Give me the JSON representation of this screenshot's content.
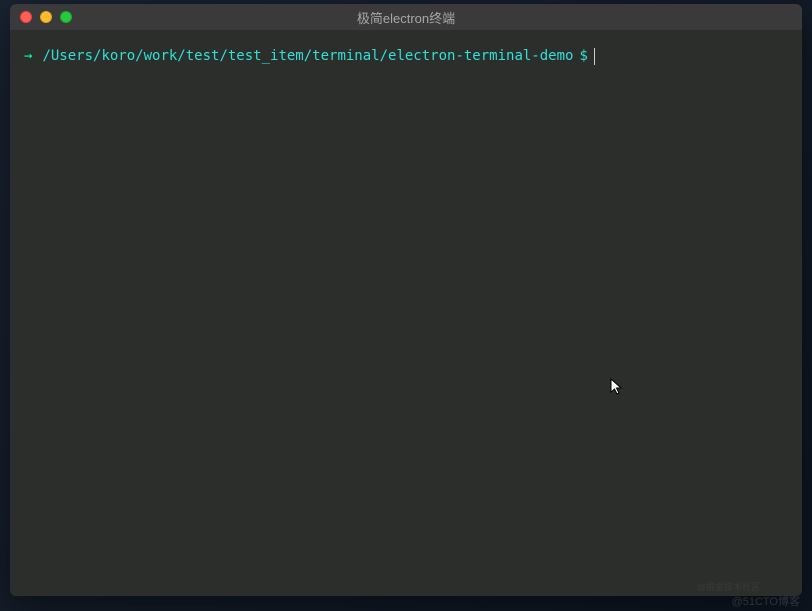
{
  "window": {
    "title": "极简electron终端"
  },
  "terminal": {
    "arrow": "→",
    "path": "/Users/koro/work/test/test_item/terminal/electron-terminal-demo",
    "prompt_symbol": "$"
  },
  "watermark": {
    "text1": "@51CTO博客",
    "text2": "@掘金技术社区"
  }
}
